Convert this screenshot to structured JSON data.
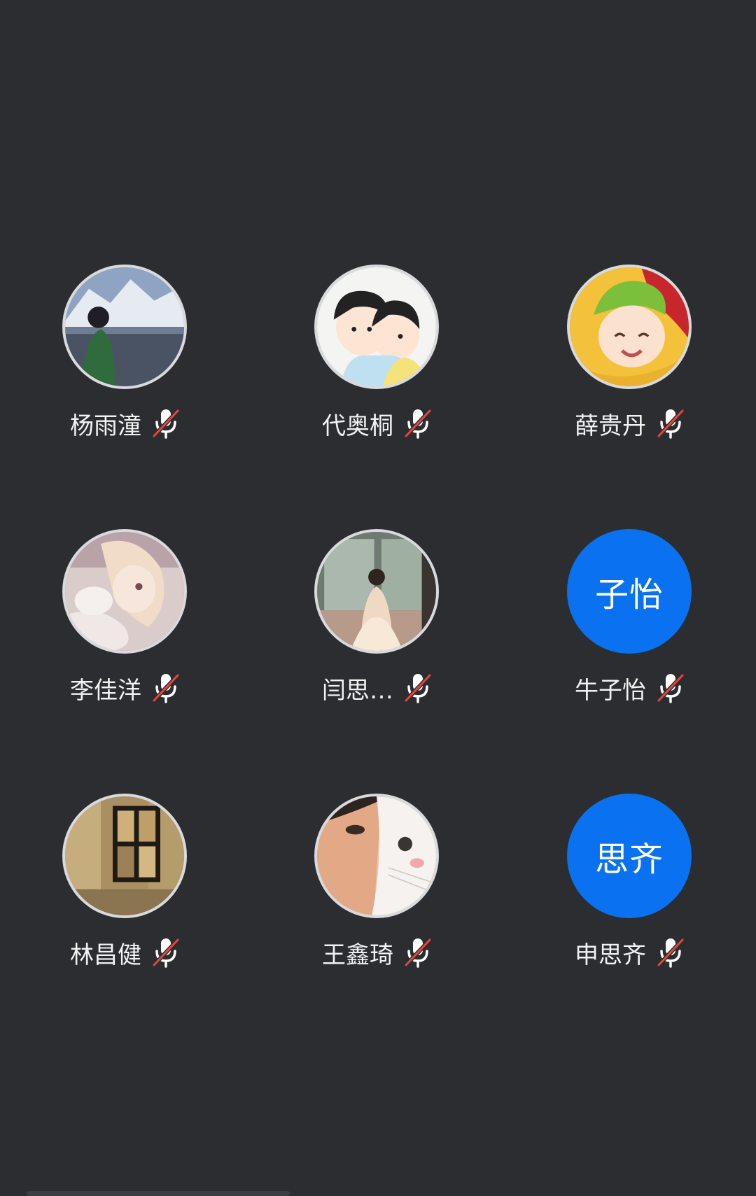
{
  "participants": [
    {
      "name": "杨雨潼",
      "avatar": "photo",
      "avatar_desc": "mountain-lake-photo",
      "mic": "muted"
    },
    {
      "name": "代奥桐",
      "avatar": "photo",
      "avatar_desc": "cartoon-couple-photo",
      "mic": "muted"
    },
    {
      "name": "薛贵丹",
      "avatar": "photo",
      "avatar_desc": "child-green-hat-photo",
      "mic": "muted"
    },
    {
      "name": "李佳洋",
      "avatar": "photo",
      "avatar_desc": "anime-girl-photo",
      "mic": "muted"
    },
    {
      "name": "闫思…",
      "avatar": "photo",
      "avatar_desc": "ballet-dancer-photo",
      "mic": "muted"
    },
    {
      "name": "牛子怡",
      "avatar": "initials",
      "initials": "子怡",
      "mic": "muted"
    },
    {
      "name": "林昌健",
      "avatar": "photo",
      "avatar_desc": "night-window-photo",
      "mic": "muted"
    },
    {
      "name": "王鑫琦",
      "avatar": "photo",
      "avatar_desc": "face-with-cat-photo",
      "mic": "muted"
    },
    {
      "name": "申思齐",
      "avatar": "initials",
      "initials": "思齐",
      "mic": "muted"
    }
  ],
  "colors": {
    "background": "#2b2d31",
    "initials_avatar": "#0a72f0",
    "mic_icon": "#ffffff",
    "mute_slash": "#e5463b",
    "name_text": "#f2f2f2"
  }
}
